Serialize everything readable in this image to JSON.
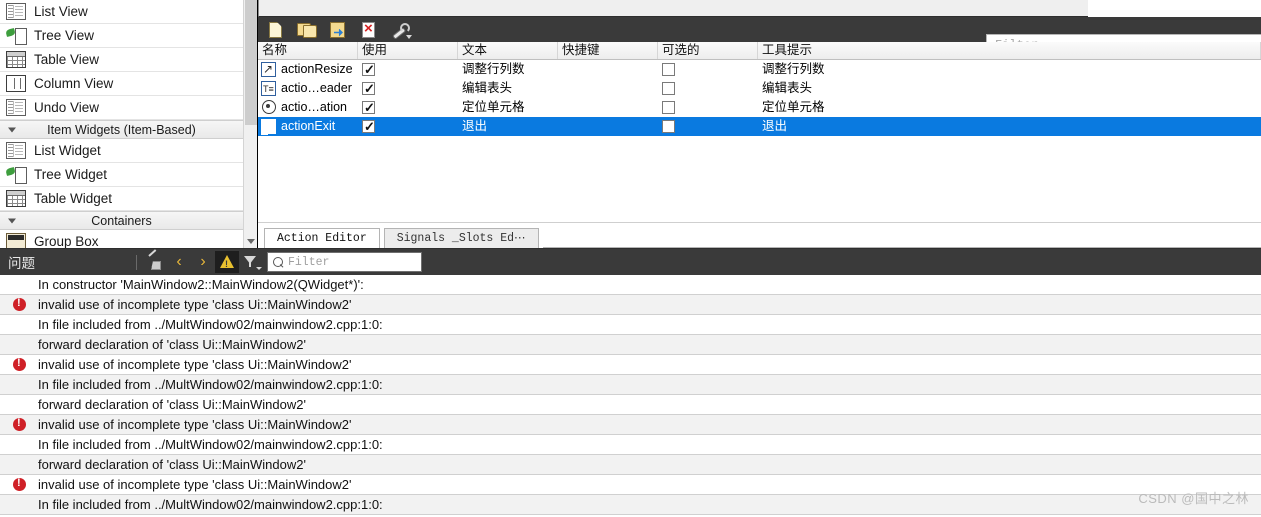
{
  "sidebar": {
    "items": [
      {
        "label": "List View",
        "icon": "list-view-icon",
        "type": "item"
      },
      {
        "label": "Tree View",
        "icon": "tree-view-icon",
        "type": "item"
      },
      {
        "label": "Table View",
        "icon": "table-view-icon",
        "type": "item"
      },
      {
        "label": "Column View",
        "icon": "column-view-icon",
        "type": "item"
      },
      {
        "label": "Undo View",
        "icon": "undo-view-icon",
        "type": "item"
      },
      {
        "label": "Item Widgets (Item-Based)",
        "icon": "collapse-triangle-icon",
        "type": "group"
      },
      {
        "label": "List Widget",
        "icon": "list-widget-icon",
        "type": "item"
      },
      {
        "label": "Tree Widget",
        "icon": "tree-widget-icon",
        "type": "item"
      },
      {
        "label": "Table Widget",
        "icon": "table-widget-icon",
        "type": "item"
      },
      {
        "label": "Containers",
        "icon": "collapse-triangle-icon",
        "type": "group"
      },
      {
        "label": "Group Box",
        "icon": "group-box-icon",
        "type": "item"
      }
    ]
  },
  "action_editor": {
    "toolbar": [
      {
        "name": "new-action-button",
        "icon": "new-document-icon",
        "label": ""
      },
      {
        "name": "copy-action-button",
        "icon": "copy-folder-icon",
        "label": ""
      },
      {
        "name": "paste-action-button",
        "icon": "paste-icon",
        "label": ""
      },
      {
        "name": "delete-action-button",
        "icon": "delete-document-icon",
        "label": ""
      },
      {
        "name": "configure-button",
        "icon": "wrench-icon",
        "label": ""
      }
    ],
    "filter": {
      "placeholder": "Filter",
      "value": ""
    },
    "columns": [
      "名称",
      "使用",
      "文本",
      "快捷键",
      "可选的",
      "工具提示"
    ],
    "rows": [
      {
        "icon": "resize-icon",
        "name": "actionResize",
        "used": true,
        "text": "调整行列数",
        "shortcut": "",
        "checkable": false,
        "tooltip": "调整行列数",
        "selected": false
      },
      {
        "icon": "header-icon",
        "name": "actio…eader",
        "used": true,
        "text": "编辑表头",
        "shortcut": "",
        "checkable": false,
        "tooltip": "编辑表头",
        "selected": false
      },
      {
        "icon": "locate-icon",
        "name": "actio…ation",
        "used": true,
        "text": "定位单元格",
        "shortcut": "",
        "checkable": false,
        "tooltip": "定位单元格",
        "selected": false
      },
      {
        "icon": "exit-icon",
        "name": "actionExit",
        "used": true,
        "text": "退出",
        "shortcut": "",
        "checkable": false,
        "tooltip": "退出",
        "selected": true
      }
    ],
    "tabs": [
      {
        "label": "Action Editor",
        "active": true
      },
      {
        "label": "Signals _Slots Ed⋯",
        "active": false
      }
    ]
  },
  "issues": {
    "title": "问题",
    "toolbar": [
      {
        "name": "clear-issues-button",
        "icon": "broom-icon"
      },
      {
        "name": "previous-issue-button",
        "icon": "chevron-left-icon",
        "glyph": "‹"
      },
      {
        "name": "next-issue-button",
        "icon": "chevron-right-icon",
        "glyph": "›"
      },
      {
        "name": "warnings-filter-button",
        "icon": "warning-triangle-icon",
        "active": true
      },
      {
        "name": "filter-button",
        "icon": "funnel-icon"
      }
    ],
    "filter": {
      "placeholder": "Filter",
      "value": ""
    },
    "rows": [
      {
        "severity": "none",
        "text": "In constructor 'MainWindow2::MainWindow2(QWidget*)':"
      },
      {
        "severity": "error",
        "text": "invalid use of incomplete type 'class Ui::MainWindow2'"
      },
      {
        "severity": "none",
        "text": "In file included from ../MultWindow02/mainwindow2.cpp:1:0:"
      },
      {
        "severity": "none",
        "text": "forward declaration of 'class Ui::MainWindow2'"
      },
      {
        "severity": "error",
        "text": "invalid use of incomplete type 'class Ui::MainWindow2'"
      },
      {
        "severity": "none",
        "text": "In file included from ../MultWindow02/mainwindow2.cpp:1:0:"
      },
      {
        "severity": "none",
        "text": "forward declaration of 'class Ui::MainWindow2'"
      },
      {
        "severity": "error",
        "text": "invalid use of incomplete type 'class Ui::MainWindow2'"
      },
      {
        "severity": "none",
        "text": "In file included from ../MultWindow02/mainwindow2.cpp:1:0:"
      },
      {
        "severity": "none",
        "text": "forward declaration of 'class Ui::MainWindow2'"
      },
      {
        "severity": "error",
        "text": "invalid use of incomplete type 'class Ui::MainWindow2'"
      },
      {
        "severity": "none",
        "text": "In file included from ../MultWindow02/mainwindow2.cpp:1:0:"
      }
    ]
  },
  "watermark": "CSDN @国中之林",
  "colors": {
    "selection": "#0a7ae0",
    "toolbar_dark": "#3a3a3a",
    "error_red": "#cf2027",
    "warn_yellow": "#e8c02f"
  }
}
